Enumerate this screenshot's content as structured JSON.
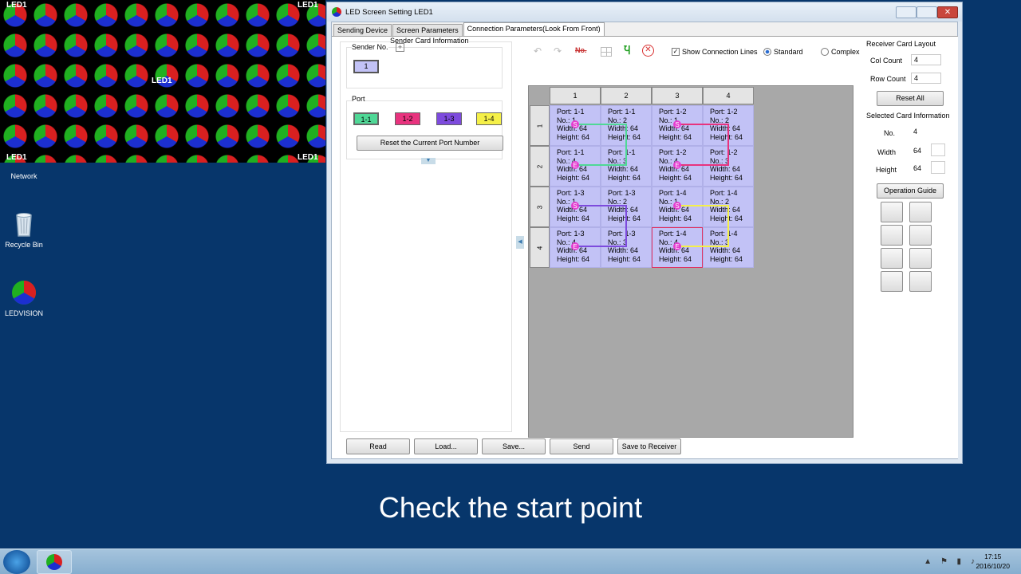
{
  "led": {
    "label": "LED1"
  },
  "desktop_icons": [
    {
      "label": "Network"
    },
    {
      "label": "Recycle Bin"
    },
    {
      "label": "LEDVISION"
    }
  ],
  "window": {
    "title": "LED Screen Setting LED1",
    "close": "✕"
  },
  "tabs": [
    {
      "label": "Sending Device"
    },
    {
      "label": "Screen Parameters"
    },
    {
      "label": "Connection Parameters(Look From Front)"
    }
  ],
  "sender": {
    "header": "Sender Card Information",
    "sender_no_label": "Sender No.",
    "sender_no_value": "1",
    "port_label": "Port",
    "ports": [
      {
        "label": "1-1",
        "color": "#4fd896"
      },
      {
        "label": "1-2",
        "color": "#e8337e"
      },
      {
        "label": "1-3",
        "color": "#7d4bdd"
      },
      {
        "label": "1-4",
        "color": "#f5f048"
      }
    ],
    "reset_port": "Reset the Current Port Number"
  },
  "toolbar": {
    "no_label": "No.",
    "show_lines": "Show Connection Lines",
    "standard": "Standard",
    "complex": "Complex"
  },
  "grid": {
    "columns": [
      "1",
      "2",
      "3",
      "4"
    ],
    "rows": [
      "1",
      "2",
      "3",
      "4"
    ],
    "cells": [
      {
        "port": "Port: 1-1",
        "no": "No.: 1",
        "width": "Width: 64",
        "height": "Height: 64"
      },
      {
        "port": "Port: 1-1",
        "no": "No.: 2",
        "width": "Width: 64",
        "height": "Height: 64"
      },
      {
        "port": "Port: 1-2",
        "no": "No.: 1",
        "width": "Width: 64",
        "height": "Height: 64"
      },
      {
        "port": "Port: 1-2",
        "no": "No.: 2",
        "width": "Width: 64",
        "height": "Height: 64"
      },
      {
        "port": "Port: 1-1",
        "no": "No.: 4",
        "width": "Width: 64",
        "height": "Height: 64"
      },
      {
        "port": "Port: 1-1",
        "no": "No.: 3",
        "width": "Width: 64",
        "height": "Height: 64"
      },
      {
        "port": "Port: 1-2",
        "no": "No.: 4",
        "width": "Width: 64",
        "height": "Height: 64"
      },
      {
        "port": "Port: 1-2",
        "no": "No.: 3",
        "width": "Width: 64",
        "height": "Height: 64"
      },
      {
        "port": "Port: 1-3",
        "no": "No.: 1",
        "width": "Width: 64",
        "height": "Height: 64"
      },
      {
        "port": "Port: 1-3",
        "no": "No.: 2",
        "width": "Width: 64",
        "height": "Height: 64"
      },
      {
        "port": "Port: 1-4",
        "no": "No.: 1",
        "width": "Width: 64",
        "height": "Height: 64"
      },
      {
        "port": "Port: 1-4",
        "no": "No.: 2",
        "width": "Width: 64",
        "height": "Height: 64"
      },
      {
        "port": "Port: 1-3",
        "no": "No.: 4",
        "width": "Width: 64",
        "height": "Height: 64"
      },
      {
        "port": "Port: 1-3",
        "no": "No.: 3",
        "width": "Width: 64",
        "height": "Height: 64"
      },
      {
        "port": "Port: 1-4",
        "no": "No.: 4",
        "width": "Width: 64",
        "height": "Height: 64"
      },
      {
        "port": "Port: 1-4",
        "no": "No.: 3",
        "width": "Width: 64",
        "height": "Height: 64"
      }
    ],
    "start_marker": "S",
    "end_marker": "E"
  },
  "receiver_layout": {
    "header": "Receiver Card Layout",
    "col_label": "Col Count",
    "col_value": "4",
    "row_label": "Row Count",
    "row_value": "4",
    "reset_all": "Reset All"
  },
  "selected_card": {
    "header": "Selected Card Information",
    "no_label": "No.",
    "no_value": "4",
    "width_label": "Width",
    "width_value": "64",
    "height_label": "Height",
    "height_value": "64",
    "guide": "Operation Guide"
  },
  "bottom_buttons": [
    {
      "label": "Read"
    },
    {
      "label": "Load..."
    },
    {
      "label": "Save..."
    },
    {
      "label": "Send"
    },
    {
      "label": "Save to Receiver"
    }
  ],
  "caption": "Check the start point",
  "taskbar": {
    "time": "17:15",
    "date": "2016/10/20"
  }
}
